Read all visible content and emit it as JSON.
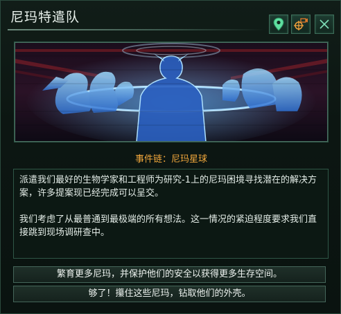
{
  "dialog": {
    "title": "尼玛特遣队",
    "icons": [
      "location-pin-icon",
      "camera-target-icon",
      "close-icon"
    ],
    "chain_label": "事件链：尼玛星球",
    "description": [
      "派遣我们最好的生物学家和工程师为研究-1上的尼玛困境寻找潜在的解决方案，许多提案现已经完成可以呈交。",
      "我们考虑了从最普通到最极端的所有想法。这一情况的紧迫程度要求我们直接跳到现场调研查中。"
    ],
    "options": [
      "繁育更多尼玛，并保护他们的安全以获得更多生存空间。",
      "够了！攥住这些尼玛，钻取他们的外壳。"
    ]
  },
  "colors": {
    "accent_orange": "#f0a73c",
    "hologram_blue": "#5fb0ff",
    "icon_green": "#66e0a0"
  }
}
